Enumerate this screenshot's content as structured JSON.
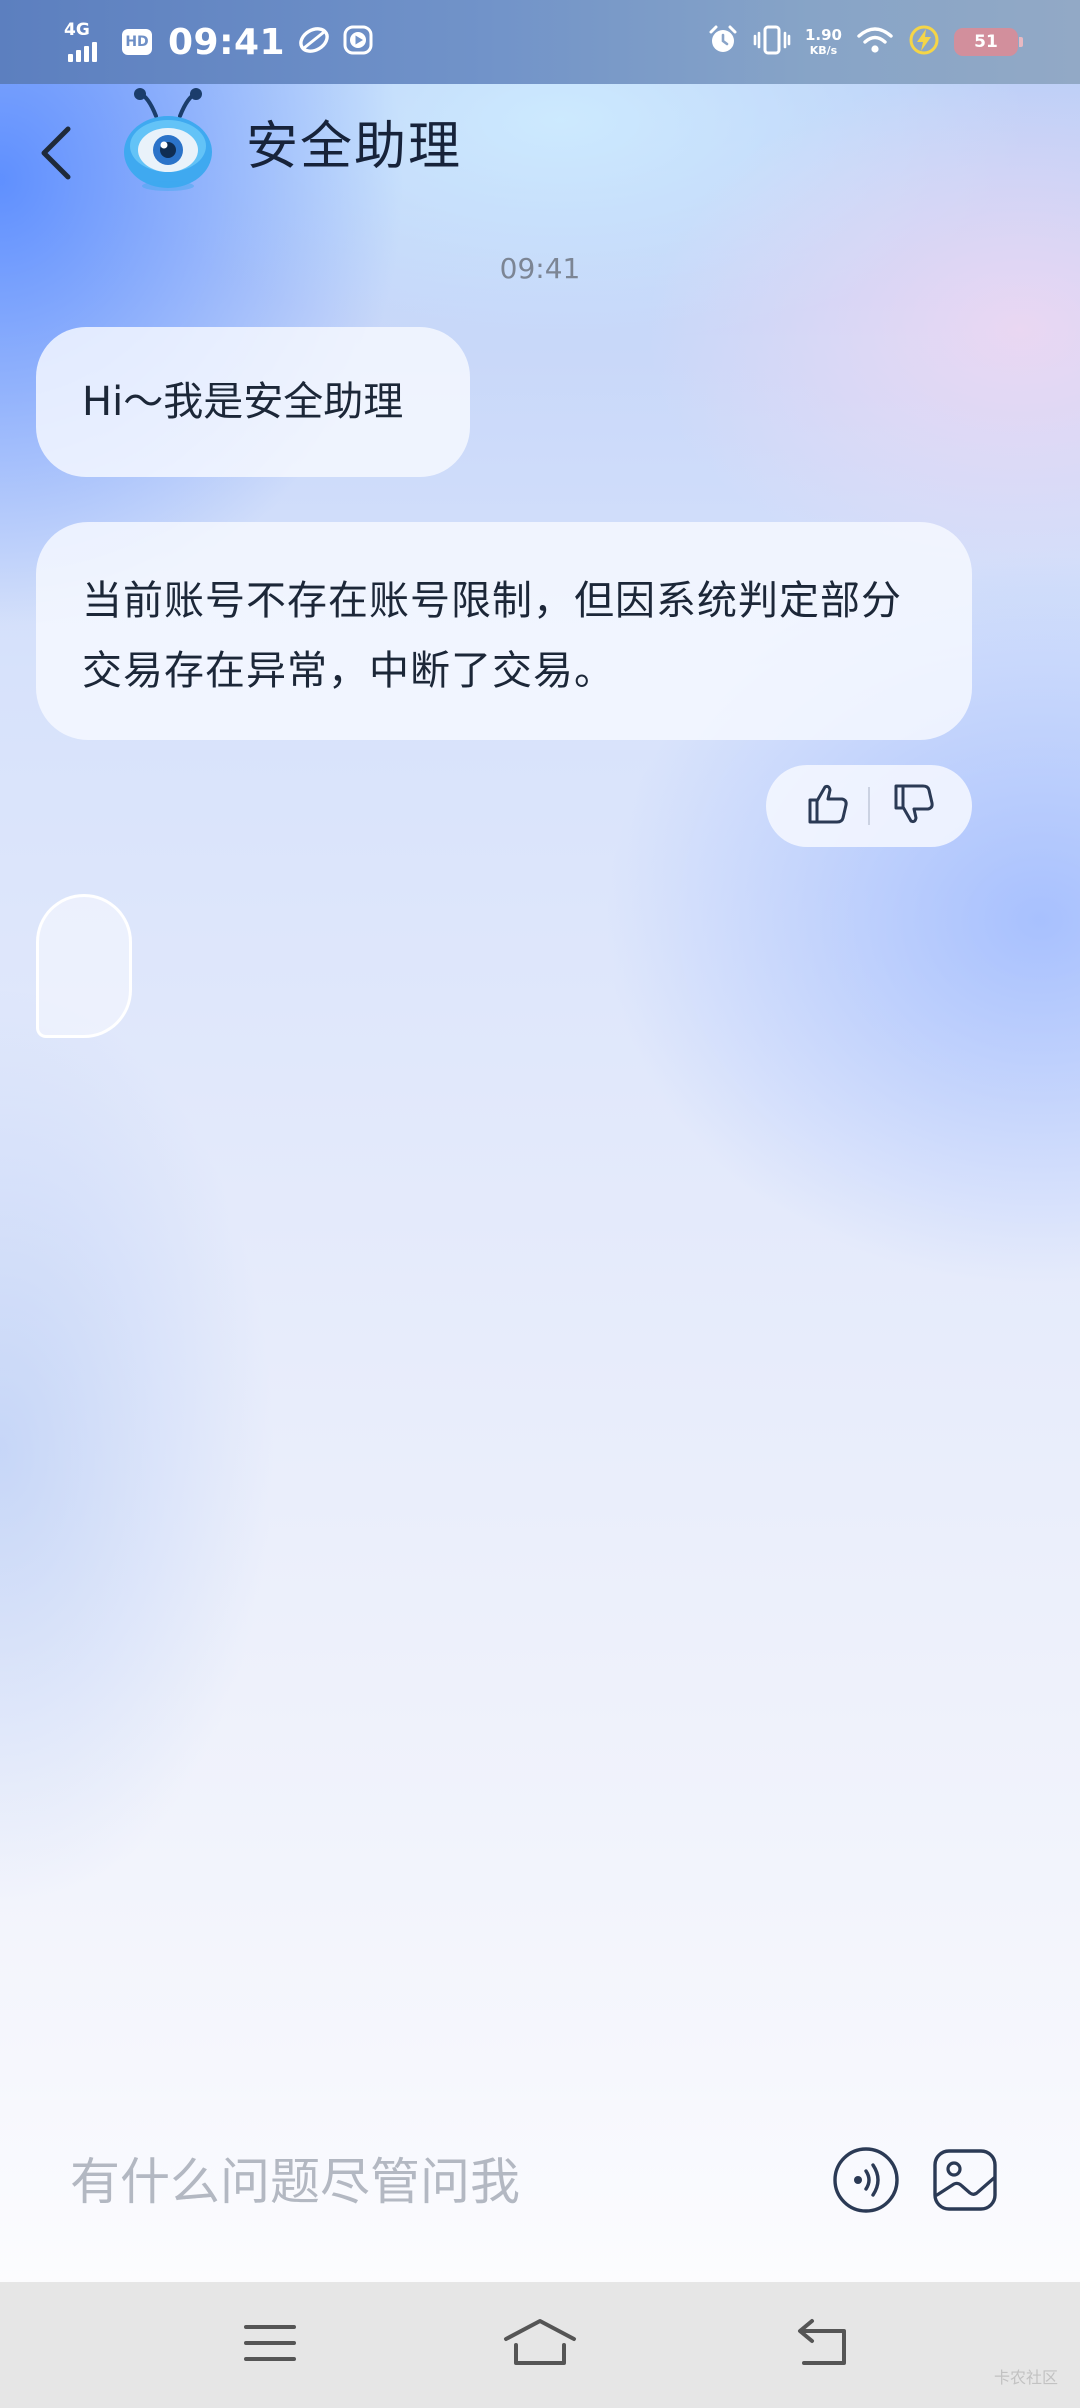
{
  "status_bar": {
    "network": "4G",
    "hd": "HD",
    "time": "09:41",
    "net_speed_value": "1.90",
    "net_speed_unit": "KB/s",
    "battery": "51",
    "icons": [
      "signal-icon",
      "hd-icon",
      "leaf-icon",
      "play-icon",
      "alarm-icon",
      "vibrate-icon",
      "wifi-icon",
      "charging-icon",
      "battery-icon"
    ]
  },
  "header": {
    "back_icon": "chevron-left-icon",
    "avatar": "assistant-robot-avatar",
    "title": "安全助理"
  },
  "chat": {
    "timestamp": "09:41",
    "messages": [
      {
        "text": "Hi～我是安全助理"
      },
      {
        "text": "当前账号不存在账号限制，但因系统判定部分交易存在异常，中断了交易。"
      }
    ],
    "feedback": {
      "like_icon": "thumbs-up-icon",
      "dislike_icon": "thumbs-down-icon"
    }
  },
  "input": {
    "placeholder": "有什么问题尽管问我",
    "voice_icon": "voice-icon",
    "image_icon": "image-icon"
  },
  "nav_bar": {
    "icons": [
      "menu-icon",
      "home-icon",
      "back-icon"
    ]
  },
  "watermark": "卡农社区",
  "colors": {
    "icon_stroke": "#2b3a55",
    "status_bar_bg": "#6e8fc6",
    "battery_bg": "#d28f9c"
  }
}
